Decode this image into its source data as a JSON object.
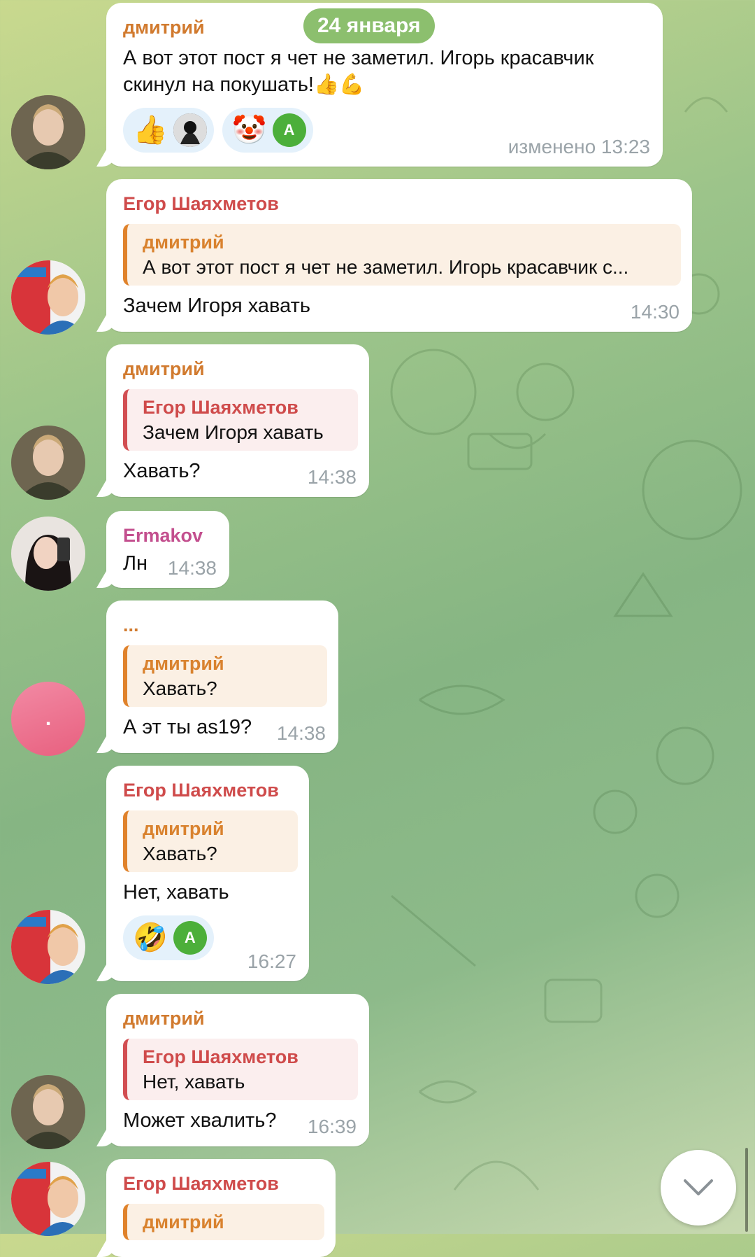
{
  "date_header": "24 января",
  "messages": [
    {
      "sender": "дмитрий",
      "text": "А вот этот пост я чет не заметил. Игорь красавчик скинул на покушать!👍💪",
      "time": "изменено 13:23",
      "reactions": [
        {
          "emoji": "👍",
          "user": "avatar-dark-hoodie"
        },
        {
          "emoji": "🤡",
          "user_initial": "А"
        }
      ]
    },
    {
      "sender": "Егор Шаяхметов",
      "reply_name": "дмитрий",
      "reply_text": "А вот этот пост я чет не заметил. Игорь красавчик с...",
      "text": "Зачем Игоря хавать",
      "time": "14:30"
    },
    {
      "sender": "дмитрий",
      "reply_name": "Егор Шаяхметов",
      "reply_text": "Зачем Игоря хавать",
      "text": "Хавать?",
      "time": "14:38"
    },
    {
      "sender": "Ermakov",
      "text": "Лн",
      "time": "14:38"
    },
    {
      "sender": "...",
      "reply_name": "дмитрий",
      "reply_text": "Хавать?",
      "text": "А эт ты as19?",
      "time": "14:38",
      "avatar_label": "."
    },
    {
      "sender": "Егор Шаяхметов",
      "reply_name": "дмитрий",
      "reply_text": "Хавать?",
      "text": "Нет, хавать",
      "time": "16:27",
      "reactions": [
        {
          "emoji": "🤣",
          "user_initial": "А"
        }
      ]
    },
    {
      "sender": "дмитрий",
      "reply_name": "Егор Шаяхметов",
      "reply_text": "Нет, хавать",
      "text": "Может хвалить?",
      "time": "16:39"
    },
    {
      "sender": "Егор Шаяхметов",
      "reply_name": "дмитрий"
    }
  ],
  "colors": {
    "orange_sender": "#d17a2e",
    "red_sender": "#cf4b4b",
    "pink_sender": "#c34f8e",
    "reaction_bg": "#e4f1fb",
    "date_pill": "#8cbf6e",
    "green_avatar": "#4caf3a"
  }
}
